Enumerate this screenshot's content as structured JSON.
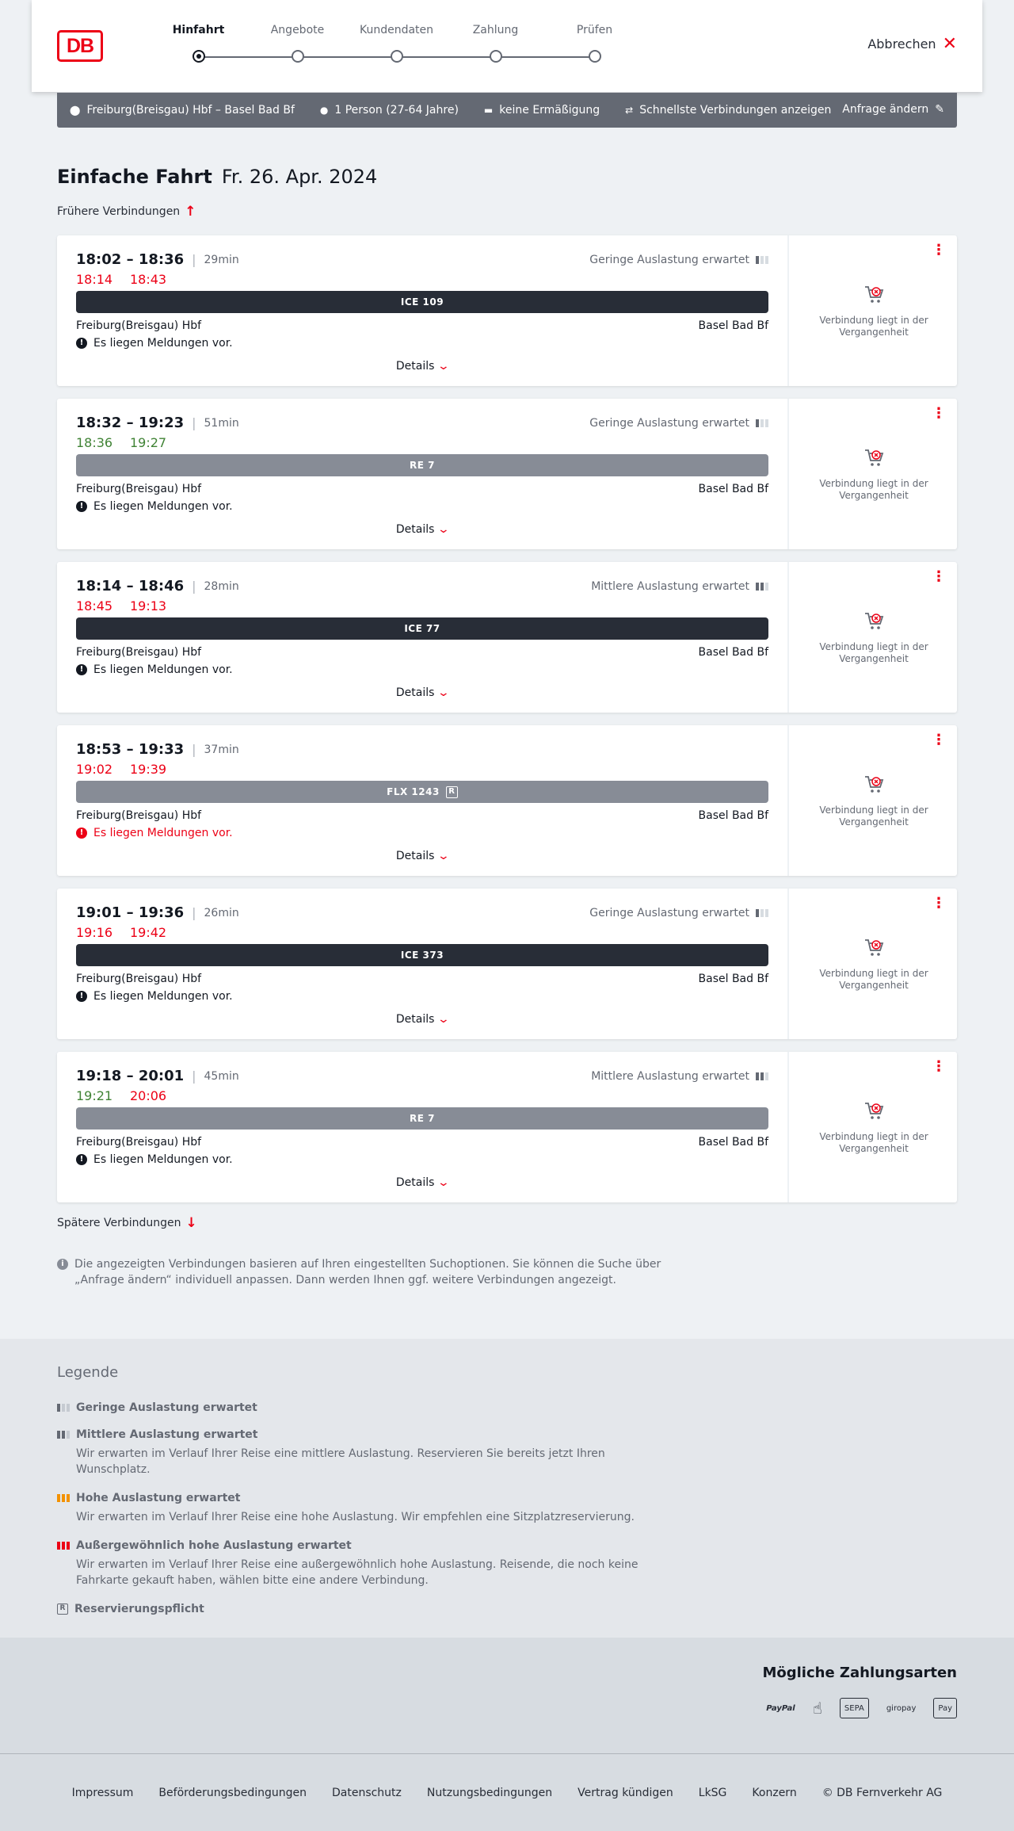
{
  "header": {
    "logo": "DB",
    "steps": [
      "Hinfahrt",
      "Angebote",
      "Kundendaten",
      "Zahlung",
      "Prüfen"
    ],
    "cancel_label": "Abbrechen"
  },
  "search": {
    "route": "Freiburg(Breisgau) Hbf – Basel Bad Bf",
    "passengers": "1 Person (27-64 Jahre)",
    "discount": "keine Ermäßigung",
    "fastest": "Schnellste Verbindungen anzeigen",
    "change_label": "Anfrage ändern"
  },
  "main": {
    "title": "Einfache Fahrt",
    "date": "Fr. 26. Apr. 2024",
    "earlier_label": "Frühere Verbindungen",
    "later_label": "Spätere Verbindungen",
    "details_label": "Details",
    "past_label": "Verbindung liegt in der Vergangenheit",
    "info_text": "Die angezeigten Verbindungen basieren auf Ihren eingestellten Suchoptionen. Sie können die Suche über „Anfrage ändern“ individuell anpassen. Dann werden Ihnen ggf. weitere Verbindungen angezeigt."
  },
  "connections": [
    {
      "planned": "18:02 – 18:36",
      "duration": "29min",
      "rt_dep": "18:14",
      "rt_arr": "18:43",
      "rt_status": "late",
      "load": "Geringe Auslastung erwartet",
      "train": "ICE 109",
      "train_type": "dark",
      "from": "Freiburg(Breisgau) Hbf",
      "to": "Basel Bad Bf",
      "notice": "Es liegen Meldungen vor.",
      "notice_alert": false
    },
    {
      "planned": "18:32 – 19:23",
      "duration": "51min",
      "rt_dep": "18:36",
      "rt_arr": "19:27",
      "rt_status": "ontime",
      "load": "Geringe Auslastung erwartet",
      "train": "RE 7",
      "train_type": "grey",
      "from": "Freiburg(Breisgau) Hbf",
      "to": "Basel Bad Bf",
      "notice": "Es liegen Meldungen vor.",
      "notice_alert": false
    },
    {
      "planned": "18:14 – 18:46",
      "duration": "28min",
      "rt_dep": "18:45",
      "rt_arr": "19:13",
      "rt_status": "late",
      "load": "Mittlere Auslastung erwartet",
      "train": "ICE 77",
      "train_type": "dark",
      "from": "Freiburg(Breisgau) Hbf",
      "to": "Basel Bad Bf",
      "notice": "Es liegen Meldungen vor.",
      "notice_alert": false
    },
    {
      "planned": "18:53 – 19:33",
      "duration": "37min",
      "rt_dep": "19:02",
      "rt_arr": "19:39",
      "rt_status": "late",
      "load": "",
      "train": "FLX 1243",
      "train_reservation": "R",
      "train_type": "grey",
      "from": "Freiburg(Breisgau) Hbf",
      "to": "Basel Bad Bf",
      "notice": "Es liegen Meldungen vor.",
      "notice_alert": true
    },
    {
      "planned": "19:01 – 19:36",
      "duration": "26min",
      "rt_dep": "19:16",
      "rt_arr": "19:42",
      "rt_status": "late",
      "load": "Geringe Auslastung erwartet",
      "train": "ICE 373",
      "train_type": "dark",
      "from": "Freiburg(Breisgau) Hbf",
      "to": "Basel Bad Bf",
      "notice": "Es liegen Meldungen vor.",
      "notice_alert": false
    },
    {
      "planned": "19:18 – 20:01",
      "duration": "45min",
      "rt_dep": "19:21",
      "rt_arr": "20:06",
      "rt_status": "mixed",
      "load": "Mittlere Auslastung erwartet",
      "train": "RE 7",
      "train_type": "grey",
      "from": "Freiburg(Breisgau) Hbf",
      "to": "Basel Bad Bf",
      "notice": "Es liegen Meldungen vor.",
      "notice_alert": false
    }
  ],
  "legend": {
    "title": "Legende",
    "items": [
      {
        "label": "Geringe Auslastung erwartet",
        "desc": ""
      },
      {
        "label": "Mittlere Auslastung erwartet",
        "desc": "Wir erwarten im Verlauf Ihrer Reise eine mittlere Auslastung. Reservieren Sie bereits jetzt Ihren Wunschplatz."
      },
      {
        "label": "Hohe Auslastung erwartet",
        "desc": "Wir erwarten im Verlauf Ihrer Reise eine hohe Auslastung. Wir empfehlen eine Sitzplatzreservierung."
      },
      {
        "label": "Außergewöhnlich hohe Auslastung erwartet",
        "desc": "Wir erwarten im Verlauf Ihrer Reise eine außergewöhnlich hohe Auslastung. Reisende, die noch keine Fahrkarte gekauft haben, wählen bitte eine andere Verbindung."
      },
      {
        "label": "Reservierungspflicht",
        "desc": ""
      }
    ],
    "reservation_glyph": "R"
  },
  "payments": {
    "title": "Mögliche Zahlungsarten",
    "logos": [
      "PayPal",
      "SEPA",
      "giropay",
      "Pay"
    ]
  },
  "footer": {
    "links": [
      "Impressum",
      "Beförderungsbedingungen",
      "Datenschutz",
      "Nutzungsbedingungen",
      "Vertrag kündigen",
      "LkSG",
      "Konzern",
      "© DB Fernverkehr AG"
    ]
  },
  "colors": {
    "brand": "#ec0016",
    "late": "#ec0016",
    "ontime": "#408335"
  }
}
